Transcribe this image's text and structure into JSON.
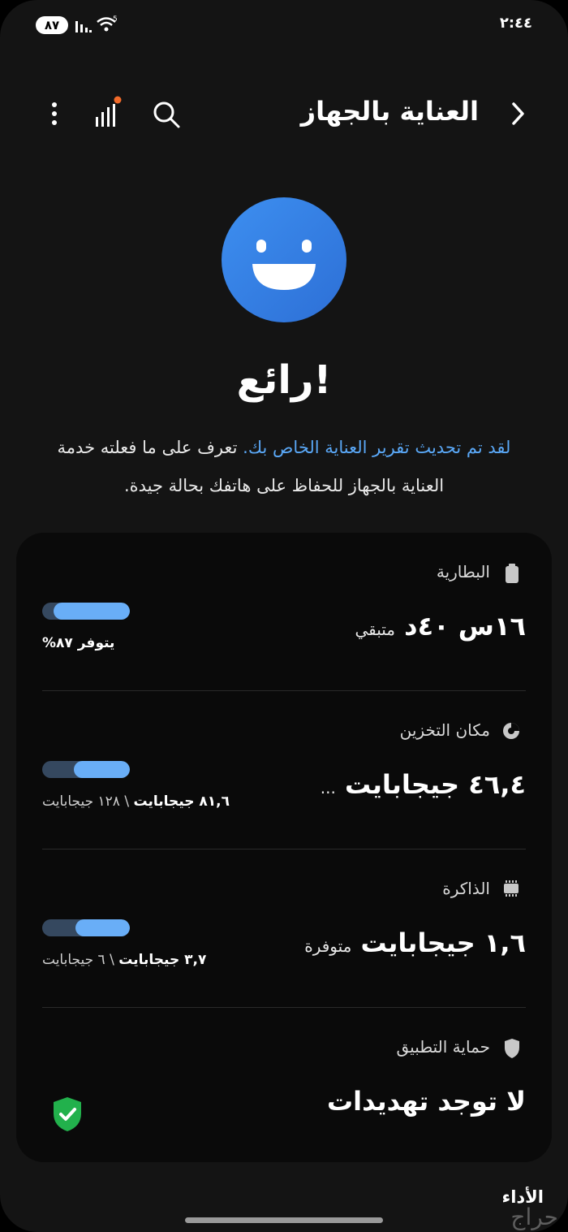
{
  "status_bar": {
    "battery": "٨٧",
    "time": "٢:٤٤"
  },
  "header": {
    "title": "العناية بالجهاز"
  },
  "hero": {
    "headline": "رائع!",
    "link_text": "لقد تم تحديث تقرير العناية الخاص بك.",
    "description_text": "تعرف على ما فعلته خدمة العناية بالجهاز للحفاظ على هاتفك بحالة جيدة."
  },
  "sections": {
    "battery": {
      "label": "البطارية",
      "value": "١٦س ٤٠د",
      "value_suffix": "متبقي",
      "sub_text": "يتوفر ٨٧%",
      "level": 0.87
    },
    "storage": {
      "label": "مكان التخزين",
      "value": "٤٦,٤ جيجابايت",
      "value_suffix": "...",
      "sub_bold": "٨١,٦ جيجابايت",
      "sub_rest": " \\ ١٢٨ جيجابايت",
      "level": 0.64
    },
    "memory": {
      "label": "الذاكرة",
      "value": "١,٦ جيجابايت",
      "value_suffix": "متوفرة",
      "sub_bold": "٣,٧ جيجابايت",
      "sub_rest": " \\ ٦ جيجابايت",
      "level": 0.62
    },
    "security": {
      "label": "حماية التطبيق",
      "value": "لا توجد تهديدات"
    }
  },
  "footer": {
    "next_section_label": "الأداء",
    "watermark": "حراج"
  },
  "colors": {
    "accent": "#69aef7",
    "bar_track": "#35485f",
    "link": "#5aa8f7",
    "smiley_blue": "#3d8ff0",
    "badge_dot": "#f26b2a",
    "shield_green": "#22b14c"
  }
}
